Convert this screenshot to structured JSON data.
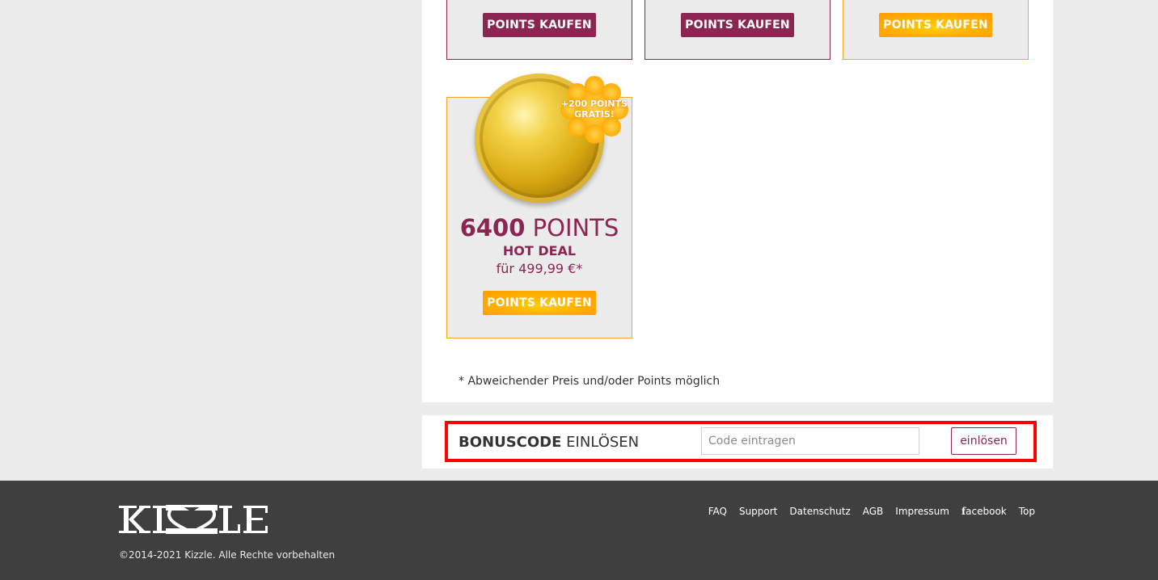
{
  "packages_top": [
    {
      "button_label": "POINTS KAUFEN",
      "style": "wine"
    },
    {
      "button_label": "POINTS KAUFEN",
      "style": "wine"
    },
    {
      "button_label": "POINTS KAUFEN",
      "style": "gold"
    }
  ],
  "hot_deal": {
    "badge_line1": "+200 POINTS",
    "badge_line2": "GRATIS!",
    "points_number": "6400",
    "points_word": "POINTS",
    "label": "HOT DEAL",
    "price": "für 499,99 €*",
    "button_label": "POINTS KAUFEN"
  },
  "note": "* Abweichender Preis und/oder Points möglich",
  "bonus": {
    "title_strong": "BONUSCODE",
    "title_rest": "EINLÖSEN",
    "input_placeholder": "Code eintragen",
    "input_value": "",
    "redeem_label": "einlösen"
  },
  "footer": {
    "logo_alt": "Kizzle",
    "copyright": "©2014-2021 Kizzle. Alle Rechte vorbehalten",
    "links": {
      "faq": "FAQ",
      "support": "Support",
      "privacy": "Datenschutz",
      "terms": "AGB",
      "imprint": "Impressum",
      "facebook_f": "f",
      "facebook_rest": "acebook",
      "top": "Top"
    }
  },
  "colors": {
    "wine": "#8b2552",
    "gold": "#ffb300",
    "highlight_frame": "#ff0000",
    "footer_bg": "#3f3f3f"
  },
  "icons": {
    "coin": "gold-coin-icon",
    "badge": "starburst-badge-icon",
    "logo": "kizzle-logo"
  }
}
